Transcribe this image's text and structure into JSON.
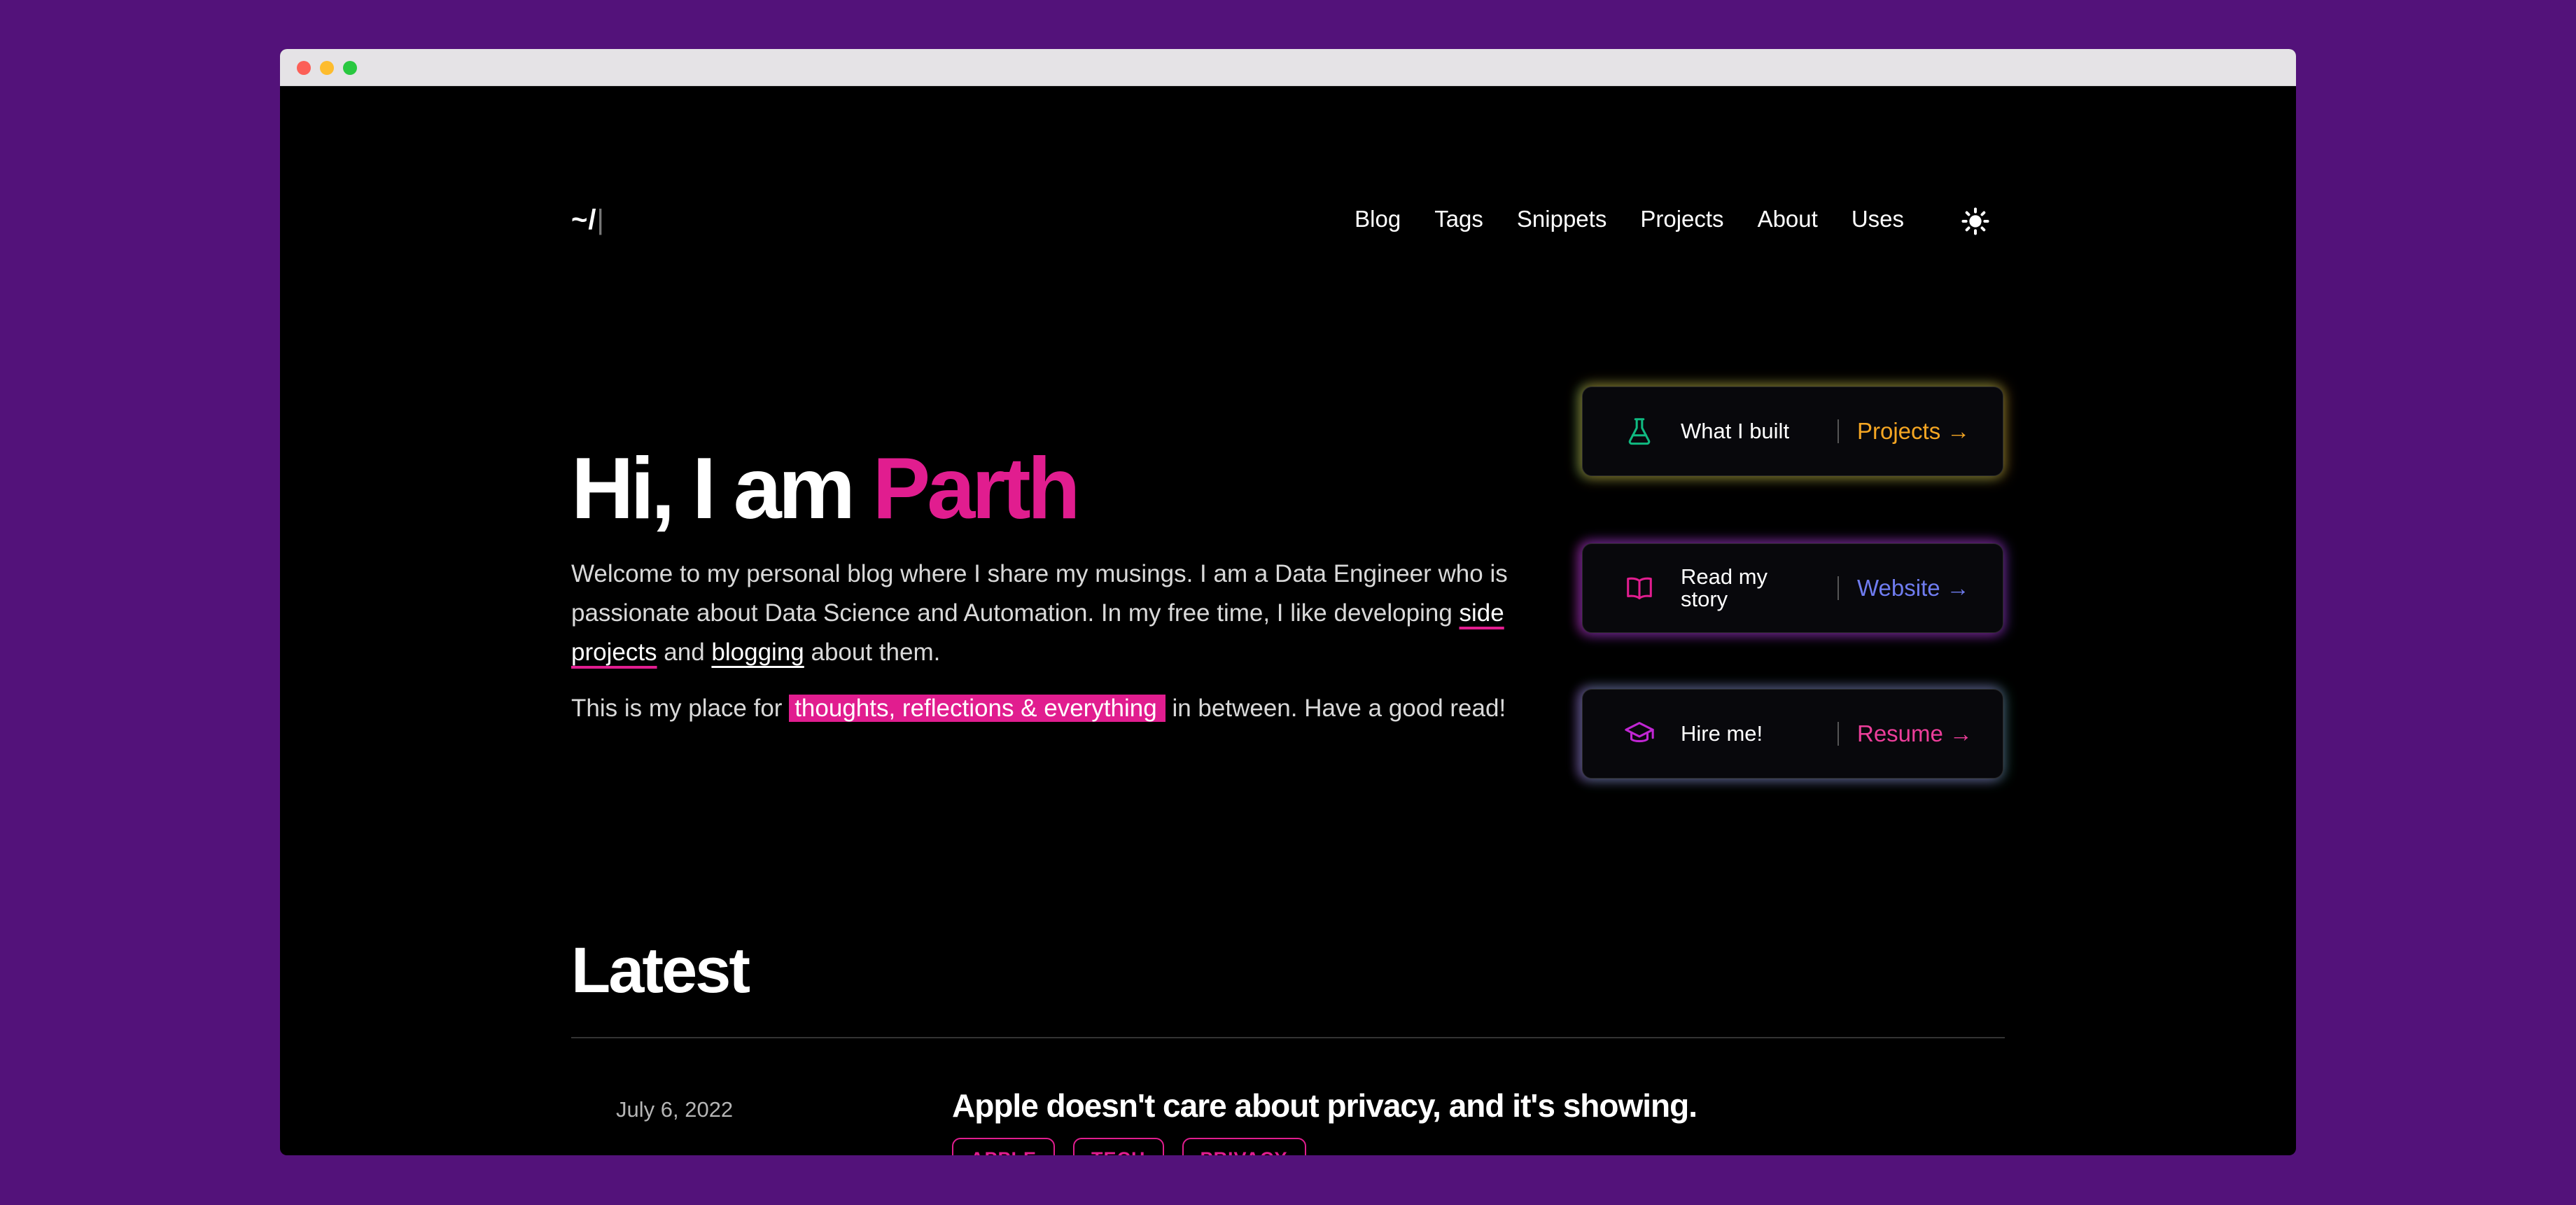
{
  "header": {
    "logo": "~/",
    "logo_cursor": "|",
    "nav": [
      "Blog",
      "Tags",
      "Snippets",
      "Projects",
      "About",
      "Uses"
    ],
    "theme_icon": "sun-icon"
  },
  "hero": {
    "title_prefix": "Hi, I am ",
    "title_name": "Parth",
    "p1_text1": "Welcome to my personal blog where I share my musings. I am a Data Engineer who is passionate about Data Science and Automation. In my free time, I like developing ",
    "p1_link1": "side projects",
    "p1_text2": " and ",
    "p1_link2": "blogging",
    "p1_text3": " about them.",
    "p2_text1": "This is my place for",
    "p2_highlight": "thoughts, reflections & everything",
    "p2_text2": "in between. Have a good read!"
  },
  "cards": [
    {
      "icon": "flask-icon",
      "label": "What I built",
      "action": "Projects →",
      "action_color": "#f5a623"
    },
    {
      "icon": "book-icon",
      "label": "Read my story",
      "action": "Website →",
      "action_color": "#6f7cf0"
    },
    {
      "icon": "graduation-cap-icon",
      "label": "Hire me!",
      "action": "Resume →",
      "action_color": "#ec3e9a"
    }
  ],
  "latest": {
    "heading": "Latest",
    "posts": [
      {
        "date": "July 6, 2022",
        "title": "Apple doesn't care about privacy, and it's showing.",
        "tags": [
          "APPLE",
          "TECH",
          "PRIVACY"
        ]
      }
    ]
  },
  "colors": {
    "accent": "#e11d8f",
    "background": "#000000",
    "desktop": "#53127a"
  }
}
